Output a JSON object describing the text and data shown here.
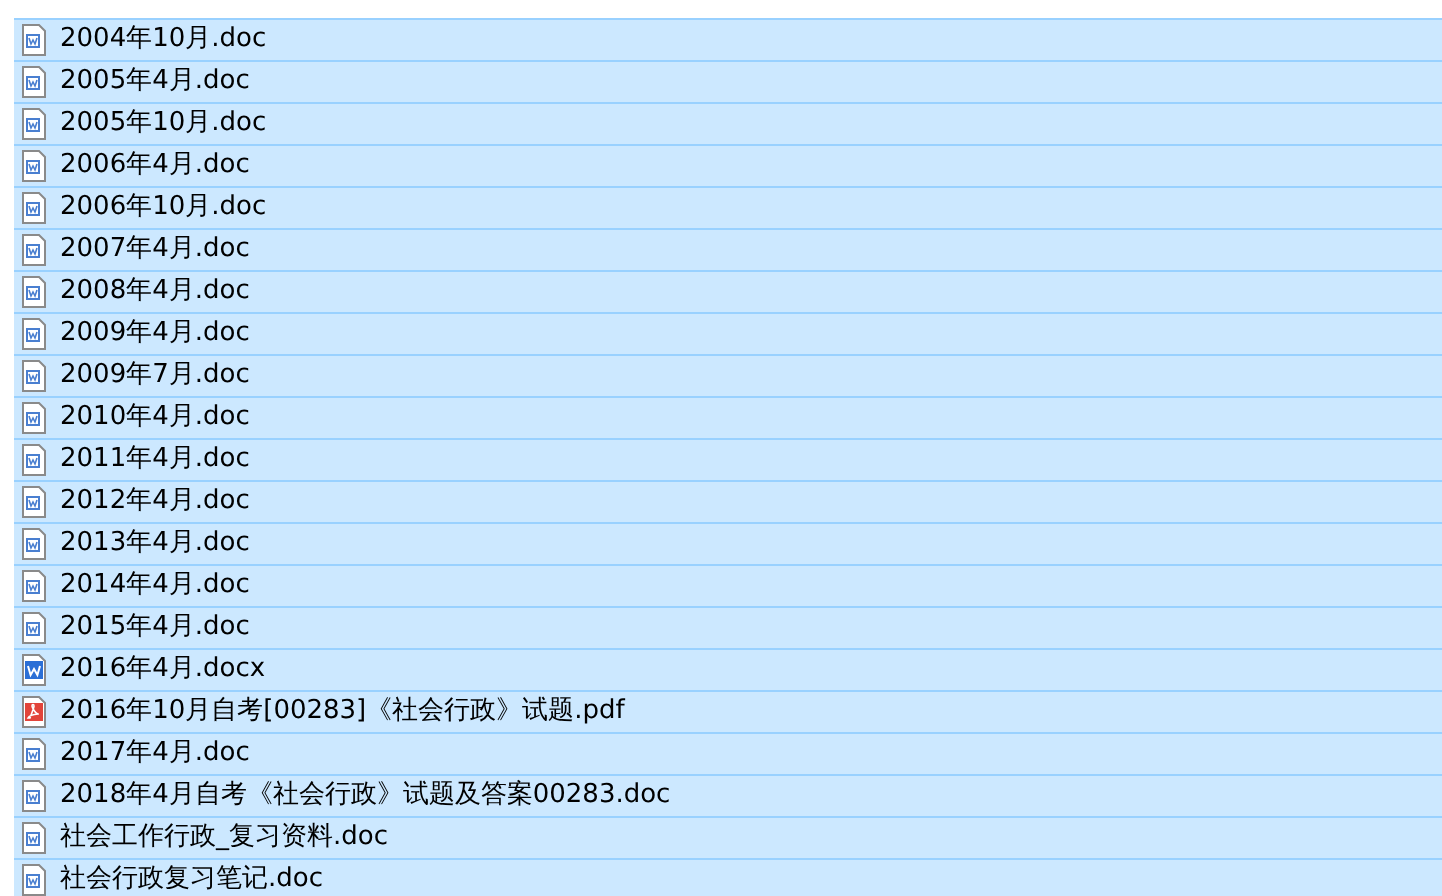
{
  "files": [
    {
      "name": "2004年10月.doc",
      "kind": "doc",
      "selected": true
    },
    {
      "name": "2005年4月.doc",
      "kind": "doc",
      "selected": true
    },
    {
      "name": "2005年10月.doc",
      "kind": "doc",
      "selected": true
    },
    {
      "name": "2006年4月.doc",
      "kind": "doc",
      "selected": true
    },
    {
      "name": "2006年10月.doc",
      "kind": "doc",
      "selected": true
    },
    {
      "name": "2007年4月.doc",
      "kind": "doc",
      "selected": true
    },
    {
      "name": "2008年4月.doc",
      "kind": "doc",
      "selected": true
    },
    {
      "name": "2009年4月.doc",
      "kind": "doc",
      "selected": true
    },
    {
      "name": "2009年7月.doc",
      "kind": "doc",
      "selected": true
    },
    {
      "name": "2010年4月.doc",
      "kind": "doc",
      "selected": true
    },
    {
      "name": "2011年4月.doc",
      "kind": "doc",
      "selected": true
    },
    {
      "name": "2012年4月.doc",
      "kind": "doc",
      "selected": true
    },
    {
      "name": "2013年4月.doc",
      "kind": "doc",
      "selected": true
    },
    {
      "name": "2014年4月.doc",
      "kind": "doc",
      "selected": true
    },
    {
      "name": "2015年4月.doc",
      "kind": "doc",
      "selected": true
    },
    {
      "name": "2016年4月.docx",
      "kind": "docx",
      "selected": true
    },
    {
      "name": "2016年10月自考[00283]《社会行政》试题.pdf",
      "kind": "pdf",
      "selected": true
    },
    {
      "name": "2017年4月.doc",
      "kind": "doc",
      "selected": true
    },
    {
      "name": "2018年4月自考《社会行政》试题及答案00283.doc",
      "kind": "doc",
      "selected": true
    },
    {
      "name": "社会工作行政_复习资料.doc",
      "kind": "doc",
      "selected": true
    },
    {
      "name": "社会行政复习笔记.doc",
      "kind": "doc",
      "selected": true
    }
  ]
}
